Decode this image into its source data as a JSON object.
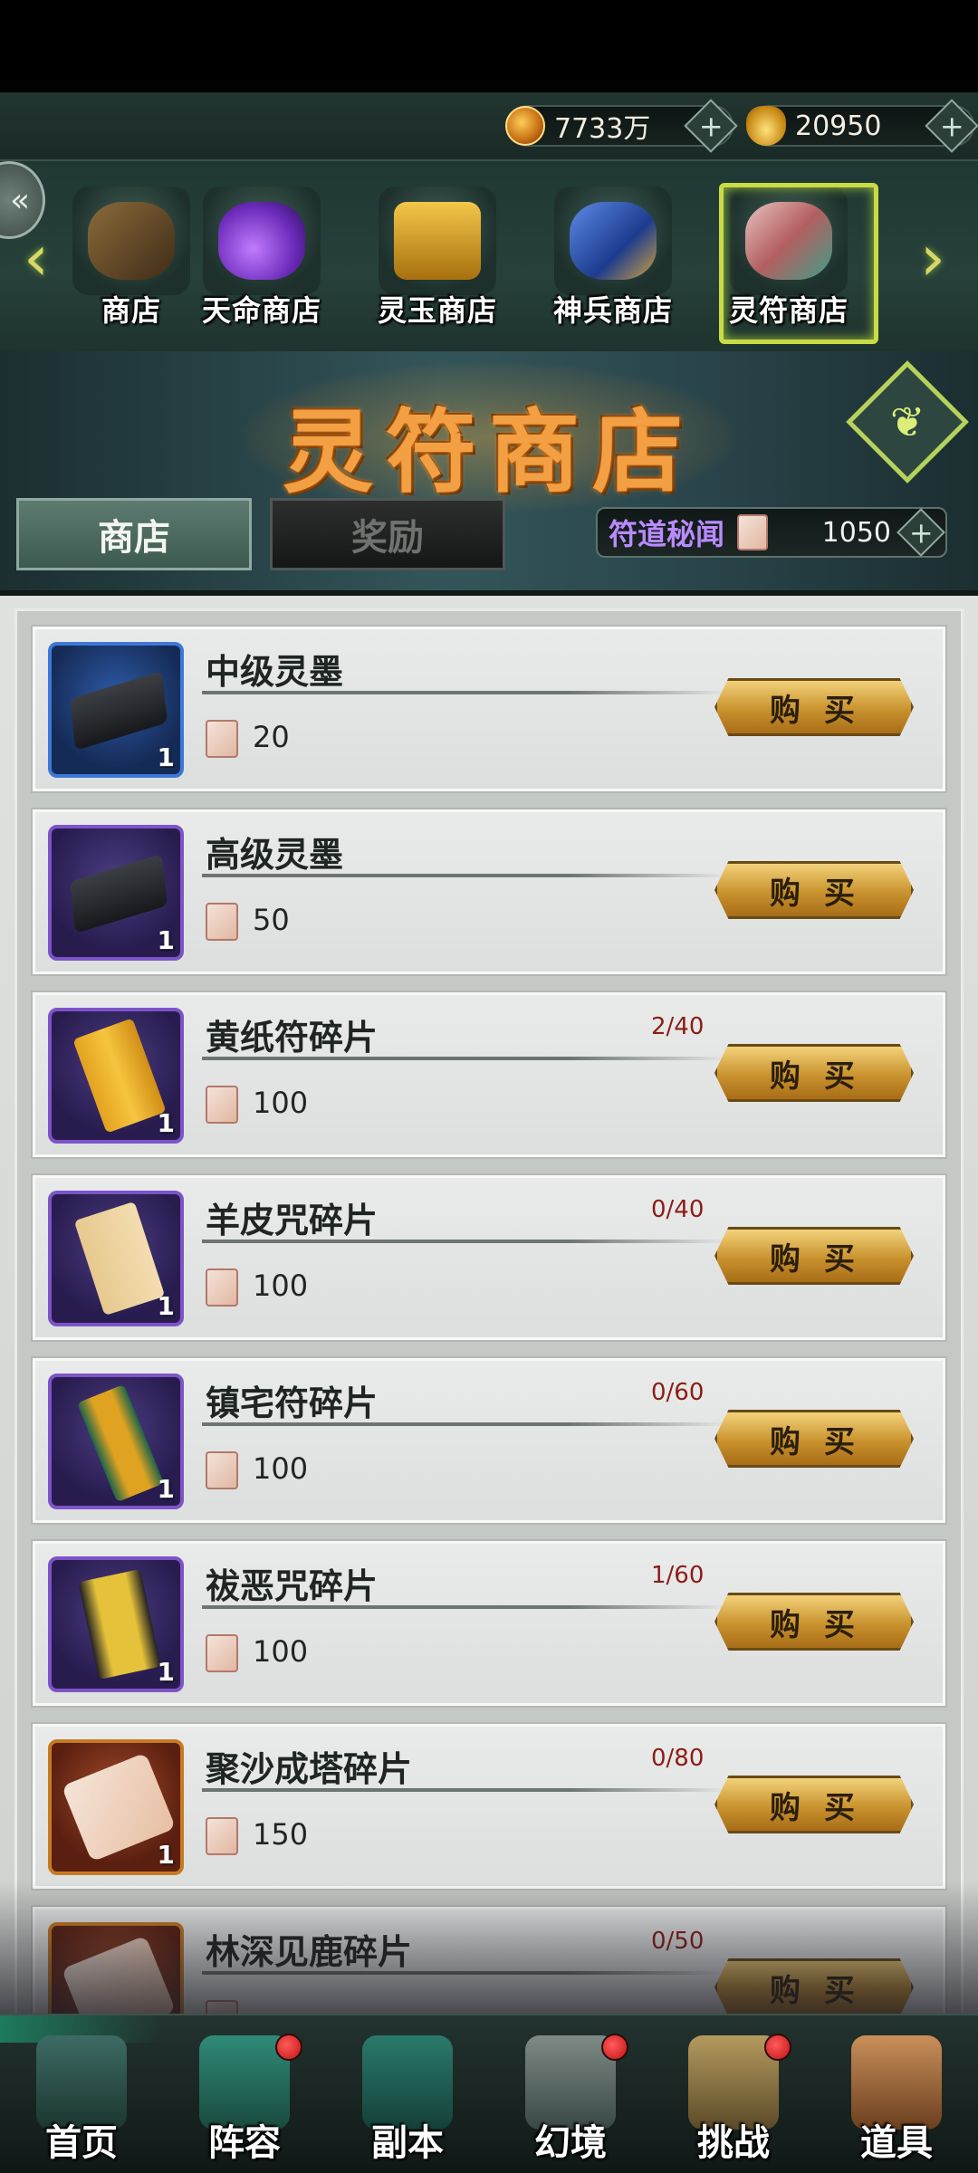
{
  "currencies": [
    {
      "value": "7733万",
      "icon": "coin-icon",
      "plus": "+"
    },
    {
      "value": "20950",
      "icon": "ingot-icon",
      "plus": "+"
    }
  ],
  "nav_arrows": {
    "left": "‹",
    "right": "›",
    "back": "«"
  },
  "shop_tabs": [
    {
      "label": "商店",
      "icon": "shop-icon",
      "color": "#8a6a3a"
    },
    {
      "label": "天命商店",
      "icon": "fate-shop-icon",
      "color": "#8b4bd6"
    },
    {
      "label": "灵玉商店",
      "icon": "jade-shop-icon",
      "color": "#d6a323"
    },
    {
      "label": "神兵商店",
      "icon": "weapon-shop-icon",
      "color": "#3b6ad1"
    },
    {
      "label": "灵符商店",
      "icon": "talisman-shop-icon",
      "color": "#c48c8c",
      "selected": true
    }
  ],
  "banner": {
    "title": "灵符商店",
    "emblem_icon": "rune-emblem-icon",
    "emblem_glyph": "❦"
  },
  "tabs": {
    "shop": "商店",
    "reward": "奖励"
  },
  "points": {
    "name": "符道秘闻",
    "value": "1050",
    "plus": "+"
  },
  "buy_label": "购买",
  "items": [
    {
      "name": "中级灵墨",
      "price": "20",
      "limit": "",
      "qty": "1",
      "frame": "blue",
      "shape": "bar"
    },
    {
      "name": "高级灵墨",
      "price": "50",
      "limit": "",
      "qty": "1",
      "frame": "purple",
      "shape": "bar"
    },
    {
      "name": "黄纸符碎片",
      "price": "100",
      "limit": "2/40",
      "qty": "1",
      "frame": "purple",
      "shape": "scroll-y"
    },
    {
      "name": "羊皮咒碎片",
      "price": "100",
      "limit": "0/40",
      "qty": "1",
      "frame": "purple",
      "shape": "scroll-p"
    },
    {
      "name": "镇宅符碎片",
      "price": "100",
      "limit": "0/60",
      "qty": "1",
      "frame": "purple",
      "shape": "scroll-g"
    },
    {
      "name": "祓恶咒碎片",
      "price": "100",
      "limit": "1/60",
      "qty": "1",
      "frame": "purple",
      "shape": "scroll-k"
    },
    {
      "name": "聚沙成塔碎片",
      "price": "150",
      "limit": "0/80",
      "qty": "1",
      "frame": "orange",
      "shape": "scroll-c"
    },
    {
      "name": "林深见鹿碎片",
      "price": "",
      "limit": "0/50",
      "qty": "1",
      "frame": "orange",
      "shape": "scroll-c"
    }
  ],
  "bottom_nav": [
    {
      "label": "首页",
      "icon": "home-icon",
      "badge": false,
      "active": true
    },
    {
      "label": "阵容",
      "icon": "lineup-icon",
      "badge": true
    },
    {
      "label": "副本",
      "icon": "dungeon-icon",
      "badge": false
    },
    {
      "label": "幻境",
      "icon": "illusion-icon",
      "badge": true
    },
    {
      "label": "挑战",
      "icon": "challenge-icon",
      "badge": true
    },
    {
      "label": "道具",
      "icon": "items-icon",
      "badge": false
    }
  ]
}
